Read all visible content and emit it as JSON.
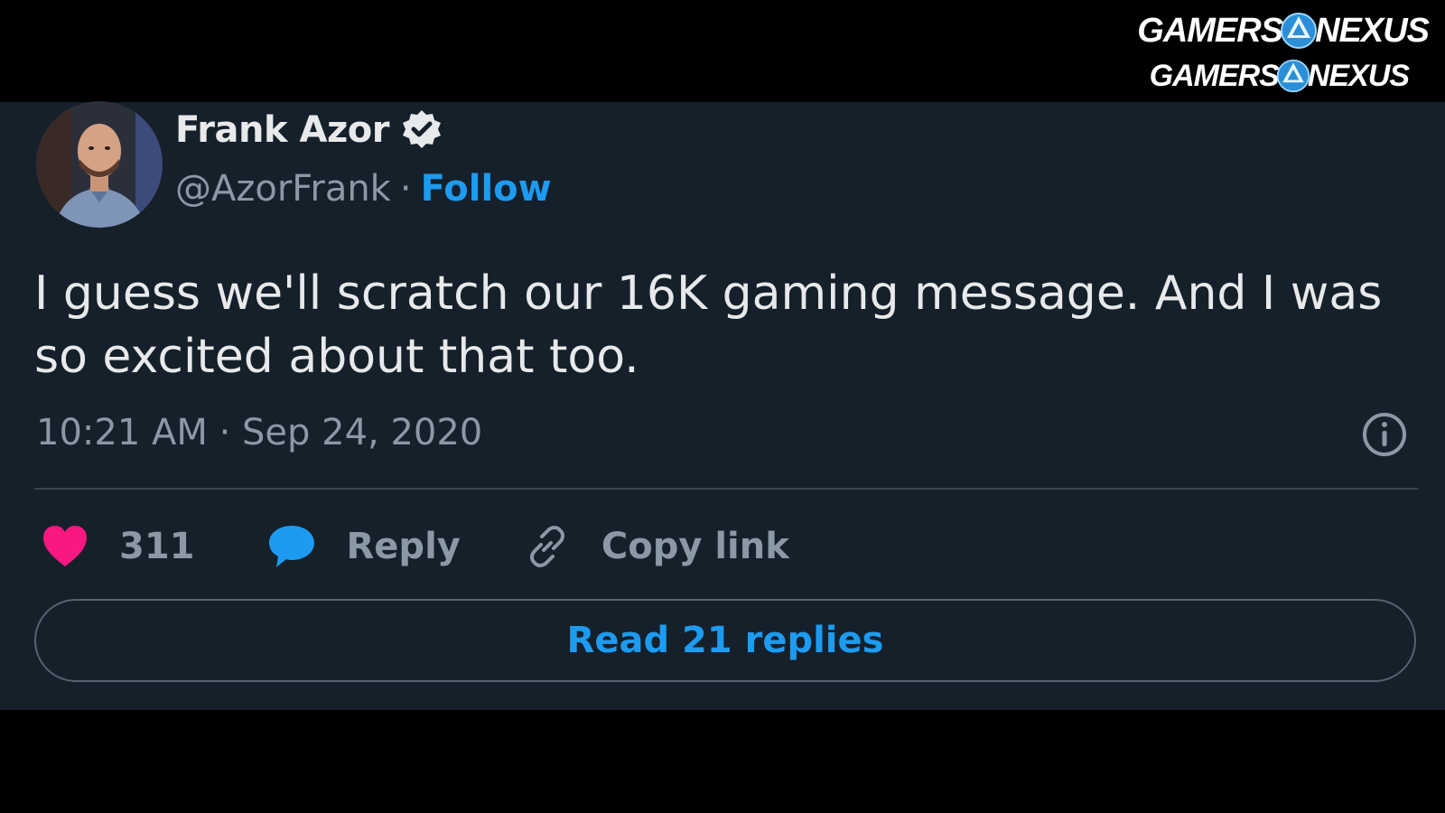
{
  "watermark": {
    "line1_left": "GAMERS",
    "line1_right": "NEXUS",
    "line2_left": "GAMERS",
    "line2_right": "NEXUS"
  },
  "tweet": {
    "author_name": "Frank Azor",
    "handle": "@AzorFrank",
    "separator": "·",
    "follow_label": "Follow",
    "text": "I guess we'll scratch our 16K gaming message. And I was so excited about that too.",
    "timestamp": "10:21 AM · Sep 24, 2020",
    "likes": "311",
    "reply_label": "Reply",
    "copy_link_label": "Copy link",
    "read_replies_label": "Read 21 replies"
  },
  "colors": {
    "background": "#15202b",
    "accent": "#1d9bf0",
    "like": "#f91880",
    "muted_text": "#8b98a5",
    "primary_text": "#e7e9ea"
  },
  "icons": [
    "verified-badge-icon",
    "info-icon",
    "heart-icon",
    "reply-bubble-icon",
    "link-icon"
  ]
}
